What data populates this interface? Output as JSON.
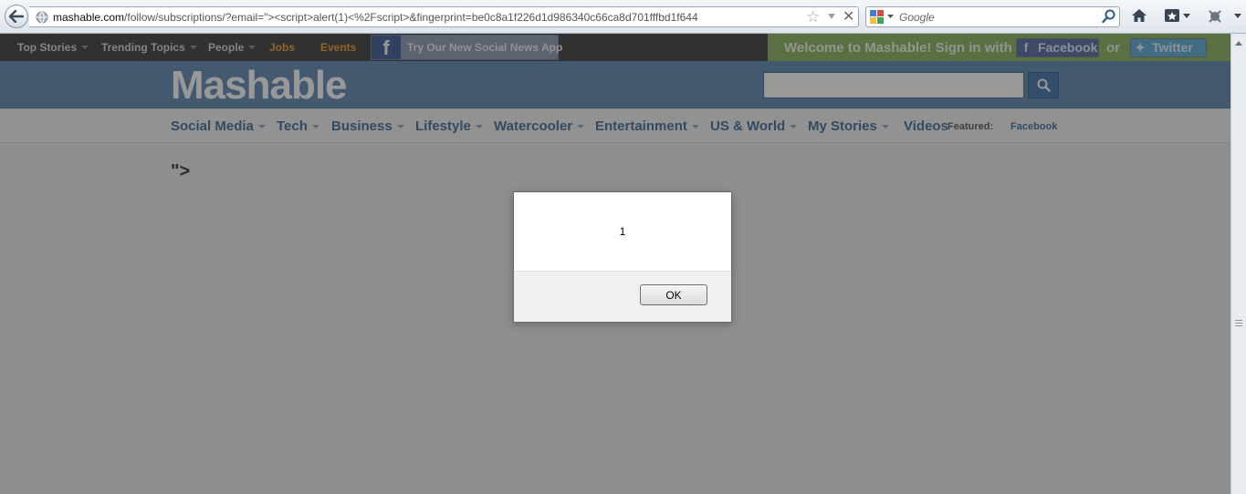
{
  "browser": {
    "url_domain": "mashable.com",
    "url_path": "/follow/subscriptions/?email=\"><script>alert(1)<%2Fscript>&fingerprint=be0c8a1f226d1d986340c66ca8d701fffbd1f644",
    "search_placeholder": "Google"
  },
  "topnav": {
    "items": [
      "Top Stories",
      "Trending Topics",
      "People",
      "Jobs",
      "Events"
    ],
    "promo_text": "Try Our New Social News App",
    "promo_icon": "f",
    "welcome_text": "Welcome to Mashable! Sign in with",
    "facebook_label": "Facebook",
    "or_text": "or",
    "twitter_label": "Twitter",
    "accent_color": "#f39a2c"
  },
  "header": {
    "logo": "Mashable",
    "brand_color": "#5a86b2"
  },
  "catnav": {
    "items": [
      "Social Media",
      "Tech",
      "Business",
      "Lifestyle",
      "Watercooler",
      "Entertainment",
      "US & World",
      "My Stories",
      "Videos"
    ],
    "featured_label": "Featured:",
    "featured_link": "Facebook"
  },
  "content": {
    "heading": "\">"
  },
  "dialog": {
    "message": "1",
    "ok_label": "OK"
  }
}
